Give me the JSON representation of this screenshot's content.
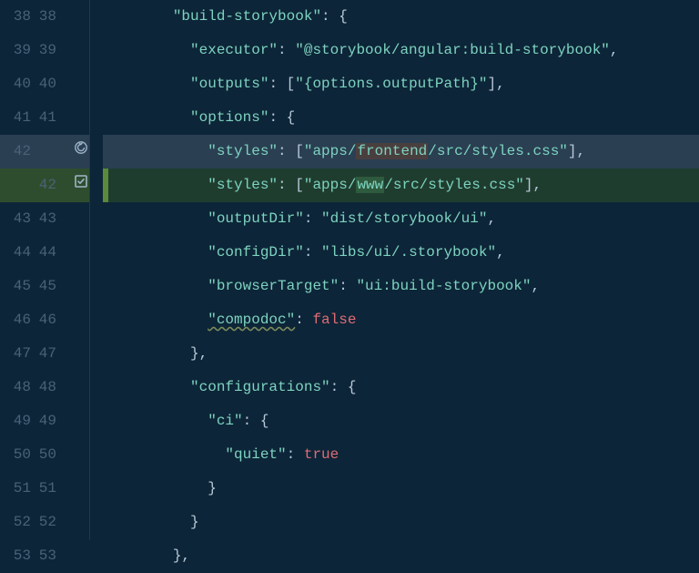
{
  "lines": [
    {
      "old": "38",
      "new": "38",
      "type": "normal",
      "indent": 8,
      "tokens": [
        [
          "key",
          "\"build-storybook\""
        ],
        [
          "punc",
          ":"
        ],
        [
          "punc",
          " {"
        ]
      ]
    },
    {
      "old": "39",
      "new": "39",
      "type": "normal",
      "indent": 10,
      "tokens": [
        [
          "key",
          "\"executor\""
        ],
        [
          "punc",
          ": "
        ],
        [
          "str",
          "\"@storybook/angular:build-storybook\""
        ],
        [
          "punc",
          ","
        ]
      ]
    },
    {
      "old": "40",
      "new": "40",
      "type": "normal",
      "indent": 10,
      "tokens": [
        [
          "key",
          "\"outputs\""
        ],
        [
          "punc",
          ": ["
        ],
        [
          "str",
          "\"{options.outputPath}\""
        ],
        [
          "punc",
          "],"
        ]
      ]
    },
    {
      "old": "41",
      "new": "41",
      "type": "normal",
      "indent": 10,
      "tokens": [
        [
          "key",
          "\"options\""
        ],
        [
          "punc",
          ": {"
        ]
      ]
    },
    {
      "old": "42",
      "new": "",
      "type": "deleted",
      "indent": 12,
      "tokens": [
        [
          "key",
          "\"styles\""
        ],
        [
          "punc",
          ": ["
        ],
        [
          "str",
          "\"apps/"
        ],
        [
          "hl-old",
          "frontend"
        ],
        [
          "str",
          "/src/styles.css\""
        ],
        [
          "punc",
          "],"
        ]
      ]
    },
    {
      "old": "",
      "new": "42",
      "type": "added",
      "indent": 12,
      "tokens": [
        [
          "key",
          "\"styles\""
        ],
        [
          "punc",
          ": ["
        ],
        [
          "str",
          "\"apps/"
        ],
        [
          "hl-new",
          "www"
        ],
        [
          "str",
          "/src/styles.css\""
        ],
        [
          "punc",
          "],"
        ]
      ]
    },
    {
      "old": "43",
      "new": "43",
      "type": "normal",
      "indent": 12,
      "tokens": [
        [
          "key",
          "\"outputDir\""
        ],
        [
          "punc",
          ": "
        ],
        [
          "str",
          "\"dist/storybook/ui\""
        ],
        [
          "punc",
          ","
        ]
      ]
    },
    {
      "old": "44",
      "new": "44",
      "type": "normal",
      "indent": 12,
      "tokens": [
        [
          "key",
          "\"configDir\""
        ],
        [
          "punc",
          ": "
        ],
        [
          "str",
          "\"libs/ui/.storybook\""
        ],
        [
          "punc",
          ","
        ]
      ]
    },
    {
      "old": "45",
      "new": "45",
      "type": "normal",
      "indent": 12,
      "tokens": [
        [
          "key",
          "\"browserTarget\""
        ],
        [
          "punc",
          ": "
        ],
        [
          "str",
          "\"ui:build-storybook\""
        ],
        [
          "punc",
          ","
        ]
      ]
    },
    {
      "old": "46",
      "new": "46",
      "type": "normal",
      "indent": 12,
      "tokens": [
        [
          "squiggle",
          "\"compodoc\""
        ],
        [
          "punc",
          ": "
        ],
        [
          "bool",
          "false"
        ]
      ]
    },
    {
      "old": "47",
      "new": "47",
      "type": "normal",
      "indent": 10,
      "tokens": [
        [
          "punc",
          "},"
        ]
      ]
    },
    {
      "old": "48",
      "new": "48",
      "type": "normal",
      "indent": 10,
      "tokens": [
        [
          "key",
          "\"configurations\""
        ],
        [
          "punc",
          ": {"
        ]
      ]
    },
    {
      "old": "49",
      "new": "49",
      "type": "normal",
      "indent": 12,
      "tokens": [
        [
          "key",
          "\"ci\""
        ],
        [
          "punc",
          ": {"
        ]
      ]
    },
    {
      "old": "50",
      "new": "50",
      "type": "normal",
      "indent": 14,
      "tokens": [
        [
          "key",
          "\"quiet\""
        ],
        [
          "punc",
          ": "
        ],
        [
          "bool",
          "true"
        ]
      ]
    },
    {
      "old": "51",
      "new": "51",
      "type": "normal",
      "indent": 12,
      "tokens": [
        [
          "punc",
          "}"
        ]
      ]
    },
    {
      "old": "52",
      "new": "52",
      "type": "normal",
      "indent": 10,
      "tokens": [
        [
          "punc",
          "}"
        ]
      ]
    },
    {
      "old": "53",
      "new": "53",
      "type": "normal",
      "indent": 8,
      "tokens": [
        [
          "punc",
          "},"
        ]
      ]
    }
  ]
}
